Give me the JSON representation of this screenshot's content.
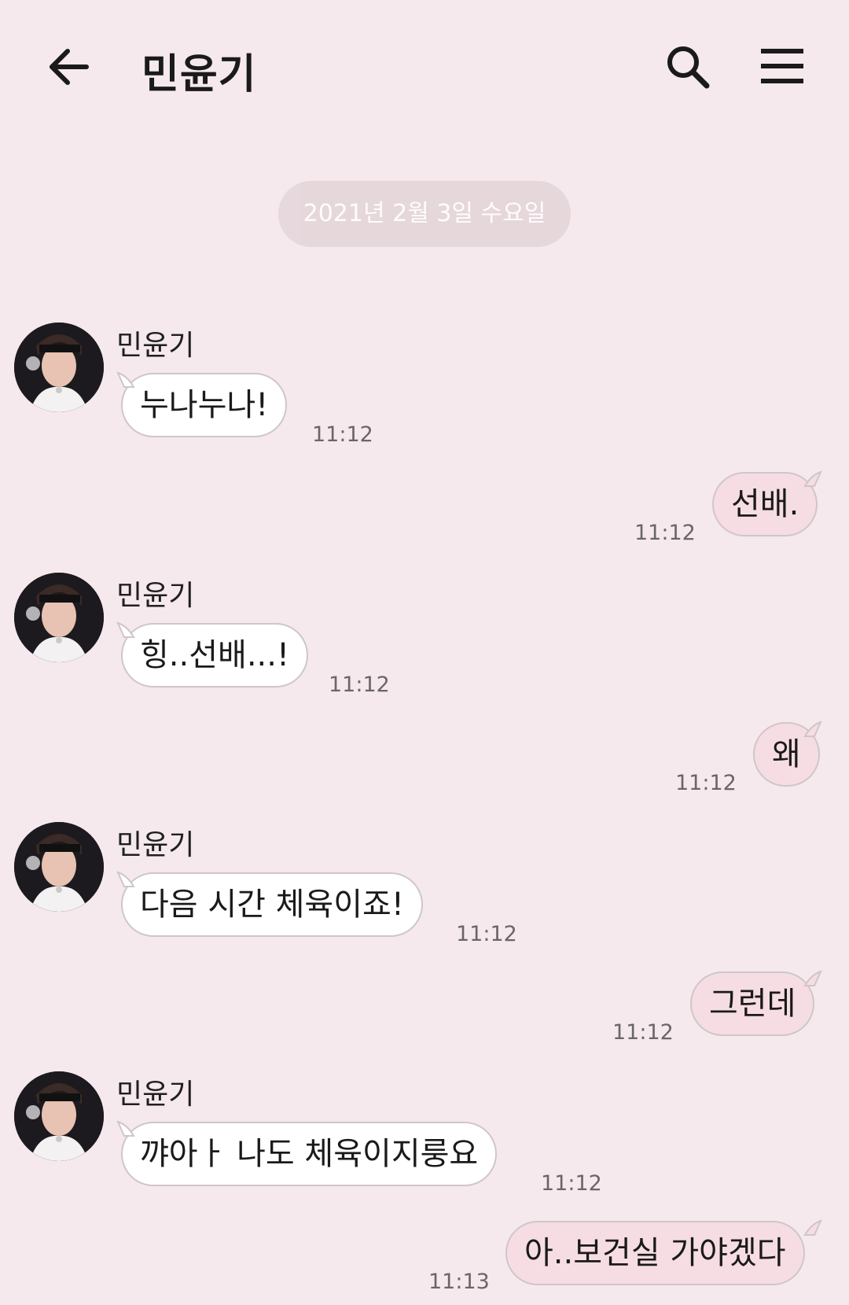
{
  "header": {
    "title": "민윤기"
  },
  "date_divider": "2021년 2월 3일 수요일",
  "contact_name": "민윤기",
  "messages": [
    {
      "from": "them",
      "sender": "민윤기",
      "text": "누나누나!",
      "time": "11:12"
    },
    {
      "from": "me",
      "text": "선배.",
      "time": "11:12"
    },
    {
      "from": "them",
      "sender": "민윤기",
      "text": "힝..선배...!",
      "time": "11:12"
    },
    {
      "from": "me",
      "text": "왜",
      "time": "11:12"
    },
    {
      "from": "them",
      "sender": "민윤기",
      "text": "다음 시간 체육이죠!",
      "time": "11:12"
    },
    {
      "from": "me",
      "text": "그런데",
      "time": "11:12"
    },
    {
      "from": "them",
      "sender": "민윤기",
      "text": "꺄아ㅏ 나도 체육이지룽요",
      "time": "11:12"
    },
    {
      "from": "me",
      "text": "아..보건실 가야겠다",
      "time": "11:13"
    }
  ],
  "colors": {
    "background": "#f5e9ed",
    "incoming_bubble": "#ffffff",
    "outgoing_bubble": "#f6dde3",
    "date_chip": "#e5d6da"
  },
  "icons": {
    "back": "arrow-left-icon",
    "search": "search-icon",
    "menu": "hamburger-menu-icon"
  }
}
